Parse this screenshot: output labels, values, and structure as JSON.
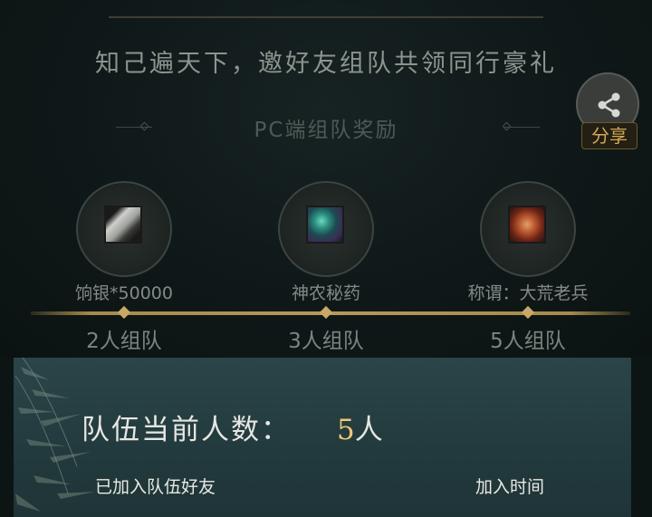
{
  "header": {
    "slogan": "知己遍天下，邀好友组队共领同行豪礼"
  },
  "share": {
    "label": "分享",
    "icon": "share-icon"
  },
  "rewards_section": {
    "title": "PC端组队奖励",
    "rewards": [
      {
        "name": "饷银*50000",
        "tier": "2人组队",
        "icon": "silver-item-icon"
      },
      {
        "name": "神农秘药",
        "tier": "3人组队",
        "icon": "medicine-item-icon"
      },
      {
        "name": "称谓：大荒老兵",
        "tier": "5人组队",
        "icon": "title-item-icon"
      }
    ]
  },
  "team_panel": {
    "count_label": "队伍当前人数：",
    "count_value": "5",
    "count_unit": "人",
    "col_members": "已加入队伍好友",
    "col_join_time": "加入时间"
  },
  "colors": {
    "accent_gold": "#f0c877",
    "progress_gold": "#b69858",
    "panel_teal": "#2a4548"
  }
}
